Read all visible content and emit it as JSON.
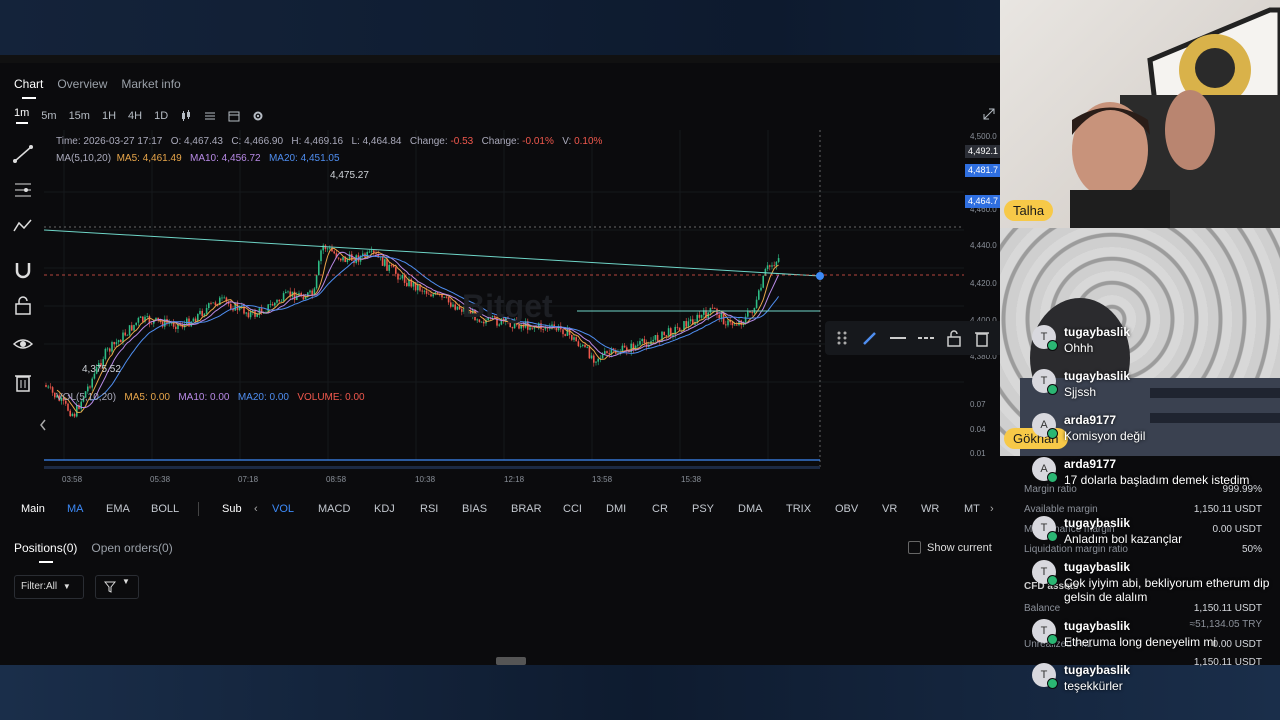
{
  "top_tabs": [
    "Chart",
    "Overview",
    "Market info"
  ],
  "timeframes": [
    "1m",
    "5m",
    "15m",
    "1H",
    "4H",
    "1D"
  ],
  "chart_info": {
    "time": "Time: 2026-03-27 17:17",
    "open": "O: 4,467.43",
    "close": "C: 4,466.90",
    "high": "H: 4,469.16",
    "low": "L: 4,464.84",
    "change_label": "Change:",
    "change": "-0.53",
    "change_pct_label": "Change:",
    "change_pct": "-0.01%",
    "v_label": "V:",
    "v": "0.10%"
  },
  "ma_info": {
    "label": "MA(5,10,20)",
    "ma5": "MA5: 4,461.49",
    "ma10": "MA10: 4,456.72",
    "ma20": "MA20: 4,451.05"
  },
  "vol_info": {
    "label": "VOL(5,10,20)",
    "ma5": "MA5: 0.00",
    "ma10": "MA10: 0.00",
    "ma20": "MA20: 0.00",
    "volume": "VOLUME: 0.00"
  },
  "watermark": "Bitget",
  "price_axis": [
    "4,500.0",
    "4,460.0",
    "4,440.0",
    "4,420.0",
    "4,400.0",
    "4,380.0"
  ],
  "vol_axis": [
    "0.07",
    "0.04",
    "0.01"
  ],
  "price_tags": {
    "crosshair": "4,492.1",
    "last": "4,481.7",
    "current": "4,464.7"
  },
  "peak_high": "4,475.27",
  "peak_low": "4,375.52",
  "time_axis": [
    "03:58",
    "05:38",
    "07:18",
    "08:58",
    "10:38",
    "12:18",
    "13:58",
    "15:38"
  ],
  "indicators_main_label": "Main",
  "indicators_main": [
    "MA",
    "EMA",
    "BOLL"
  ],
  "indicators_sub_label": "Sub",
  "indicators_sub": [
    "VOL",
    "MACD",
    "KDJ",
    "RSI",
    "BIAS",
    "BRAR",
    "CCI",
    "DMI",
    "CR",
    "PSY",
    "DMA",
    "TRIX",
    "OBV",
    "VR",
    "WR",
    "MT"
  ],
  "positions_tabs": [
    "Positions(0)",
    "Open orders(0)"
  ],
  "show_current": "Show current",
  "filter_label": "Filter:All",
  "colors": {
    "up": "#2ebd85",
    "down": "#f0584d",
    "accent": "#3d8af7",
    "badge": "#f7c948"
  },
  "webcam": {
    "top_name": "Talha",
    "bottom_name": "Gökhan"
  },
  "account_panel": {
    "rows": [
      {
        "label": "Margin ratio",
        "value": "999.99%"
      },
      {
        "label": "Available margin",
        "value": "1,150.11 USDT"
      },
      {
        "label": "Maintenance margin",
        "value": "0.00 USDT"
      },
      {
        "label": "Liquidation margin ratio",
        "value": "50%"
      },
      {
        "label": "Balance",
        "value": "1,150.11 USDT"
      },
      {
        "label": "",
        "value": "≈51,134.05 TRY"
      },
      {
        "label": "Unrealized PnL",
        "value": "0.00 USDT"
      },
      {
        "label": "",
        "value": "1,150.11 USDT"
      }
    ],
    "section": "CFD assets"
  },
  "chat": [
    {
      "user": "tugaybaslik",
      "avatar": "T",
      "msg": "Ohhh"
    },
    {
      "user": "tugaybaslik",
      "avatar": "T",
      "msg": "Sjjssh"
    },
    {
      "user": "arda9177",
      "avatar": "A",
      "msg": "Komisyon değil"
    },
    {
      "user": "arda9177",
      "avatar": "A",
      "msg": "17 dolarla başladım demek istedim"
    },
    {
      "user": "tugaybaslik",
      "avatar": "T",
      "msg": "Anladım bol kazançlar"
    },
    {
      "user": "tugaybaslik",
      "avatar": "T",
      "msg": "Çok iyiyim abi, bekliyorum etherum dip gelsin de alalım"
    },
    {
      "user": "tugaybaslik",
      "avatar": "T",
      "msg": "Etheruma long deneyelim mi"
    },
    {
      "user": "tugaybaslik",
      "avatar": "T",
      "msg": "teşekkürler"
    }
  ]
}
